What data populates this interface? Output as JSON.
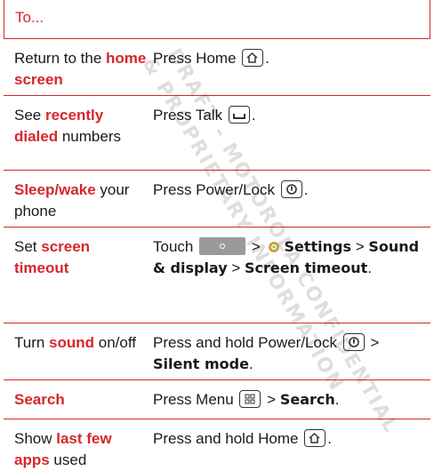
{
  "header": {
    "label": "To..."
  },
  "rows": [
    {
      "a": [
        {
          "t": "Return to the "
        },
        {
          "t": "home screen",
          "s": "red"
        }
      ],
      "b": [
        {
          "t": "Press Home "
        },
        {
          "icon": "home-key"
        },
        {
          "t": "."
        }
      ]
    },
    {
      "a": [
        {
          "t": "See "
        },
        {
          "t": "recently dialed",
          "s": "red"
        },
        {
          "t": " numbers"
        }
      ],
      "b": [
        {
          "t": "Press Talk "
        },
        {
          "icon": "talk-key"
        },
        {
          "t": "."
        }
      ]
    },
    {
      "a": [
        {
          "t": "Sleep/wake",
          "s": "red"
        },
        {
          "t": " your phone"
        }
      ],
      "b": [
        {
          "t": "Press Power/Lock "
        },
        {
          "icon": "power-key"
        },
        {
          "t": "."
        }
      ]
    },
    {
      "a": [
        {
          "t": "Set "
        },
        {
          "t": "screen timeout",
          "s": "red"
        }
      ],
      "b": [
        {
          "t": "Touch "
        },
        {
          "icon": "launcher"
        },
        {
          "t": " > "
        },
        {
          "icon": "settings-gear"
        },
        {
          "t": "Settings",
          "s": "b"
        },
        {
          "t": " > "
        },
        {
          "t": "Sound & display",
          "s": "b"
        },
        {
          "t": " > "
        },
        {
          "t": "Screen timeout",
          "s": "b"
        },
        {
          "t": "."
        }
      ]
    },
    {
      "a": [
        {
          "t": "Turn "
        },
        {
          "t": "sound",
          "s": "red"
        },
        {
          "t": " on/off"
        }
      ],
      "b": [
        {
          "t": "Press and hold Power/Lock "
        },
        {
          "icon": "power-key"
        },
        {
          "t": " > "
        },
        {
          "t": "Silent mode",
          "s": "b"
        },
        {
          "t": "."
        }
      ]
    },
    {
      "a": [
        {
          "t": "Search",
          "s": "red"
        }
      ],
      "b": [
        {
          "t": "Press Menu "
        },
        {
          "icon": "menu-key"
        },
        {
          "t": " > "
        },
        {
          "t": "Search",
          "s": "b"
        },
        {
          "t": "."
        }
      ]
    },
    {
      "a": [
        {
          "t": "Show "
        },
        {
          "t": "last few apps",
          "s": "red"
        },
        {
          "t": " used"
        }
      ],
      "b": [
        {
          "t": "Press and hold Home "
        },
        {
          "icon": "home-key"
        },
        {
          "t": "."
        }
      ]
    }
  ],
  "watermark": [
    "DRAFT - MOTOROLA CONFIDENTIAL",
    "& PROPRIETARY INFORMATION"
  ],
  "colors": {
    "accent": "#d7262b",
    "text": "#1a1a1a"
  }
}
